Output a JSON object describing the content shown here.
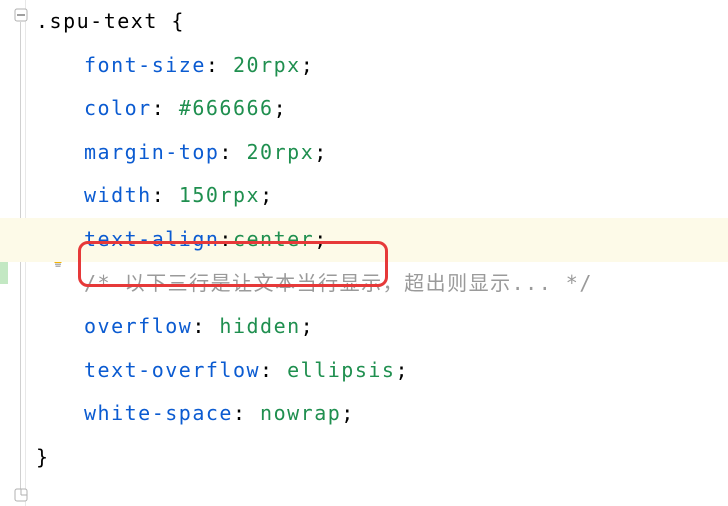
{
  "selector": ".spu-text",
  "brace_open": "{",
  "brace_close": "}",
  "lines": [
    {
      "property": "font-size",
      "colon": ": ",
      "value": "20",
      "unit": "rpx",
      "semi": ";"
    },
    {
      "property": "color",
      "colon": ": ",
      "value": "#666666",
      "semi": ";"
    },
    {
      "property": "margin-top",
      "colon": ": ",
      "value": "20",
      "unit": "rpx",
      "semi": ";"
    },
    {
      "property": "width",
      "colon": ": ",
      "value": "150",
      "unit": "rpx",
      "semi": ";"
    },
    {
      "property": "text-align",
      "colon": ":",
      "value": "center",
      "semi": ";"
    }
  ],
  "comment": "/* 以下三行是让文本当行显示，超出则显示... */",
  "lines2": [
    {
      "property": "overflow",
      "colon": ": ",
      "value": "hidden",
      "semi": ";"
    },
    {
      "property": "text-overflow",
      "colon": ": ",
      "value": "ellipsis",
      "semi": ";"
    },
    {
      "property": "white-space",
      "colon": ": ",
      "value": "nowrap",
      "semi": ";"
    }
  ],
  "icons": {
    "bulb_color": "#f4b400",
    "fold_color": "#9a9a9a"
  }
}
